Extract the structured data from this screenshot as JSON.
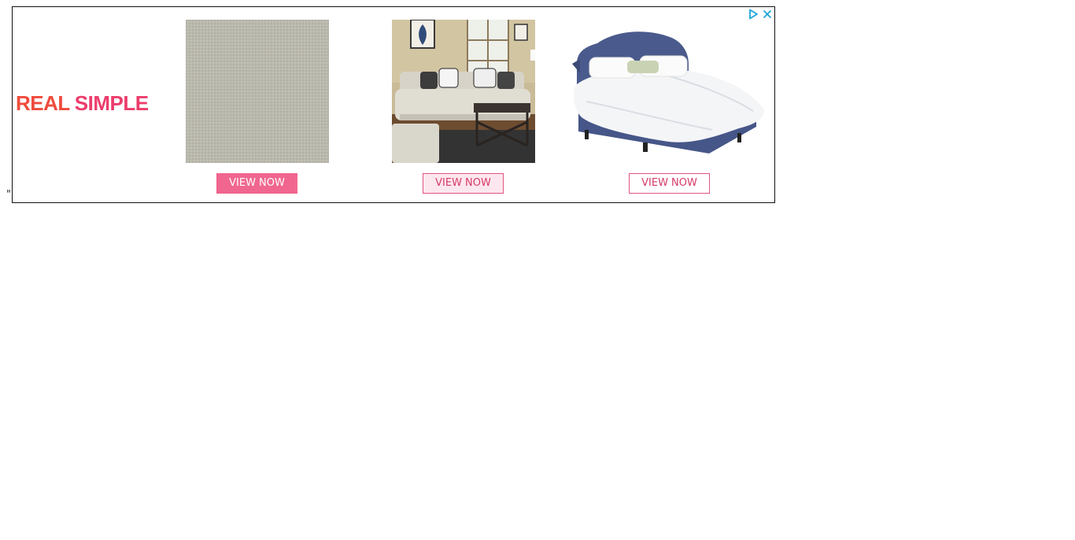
{
  "stray_text": "\"",
  "brand": {
    "word1": "REAL",
    "word2": "SIMPLE"
  },
  "ad_controls": {
    "adchoices_icon": "adchoices-play-icon",
    "close_icon": "close-x-icon"
  },
  "products": [
    {
      "image": "grey-linen-fabric-swatch",
      "button_label": "VIEW NOW",
      "button_style": "filled"
    },
    {
      "image": "living-room-sofa-set",
      "button_label": "VIEW NOW",
      "button_style": "hover"
    },
    {
      "image": "navy-upholstered-bed",
      "button_label": "VIEW NOW",
      "button_style": "outline"
    }
  ],
  "colors": {
    "brand_real": "#ef4b3c",
    "brand_simple": "#ec3d6c",
    "button_pink": "#f0668f",
    "adchoices_blue": "#1fa5d8"
  }
}
